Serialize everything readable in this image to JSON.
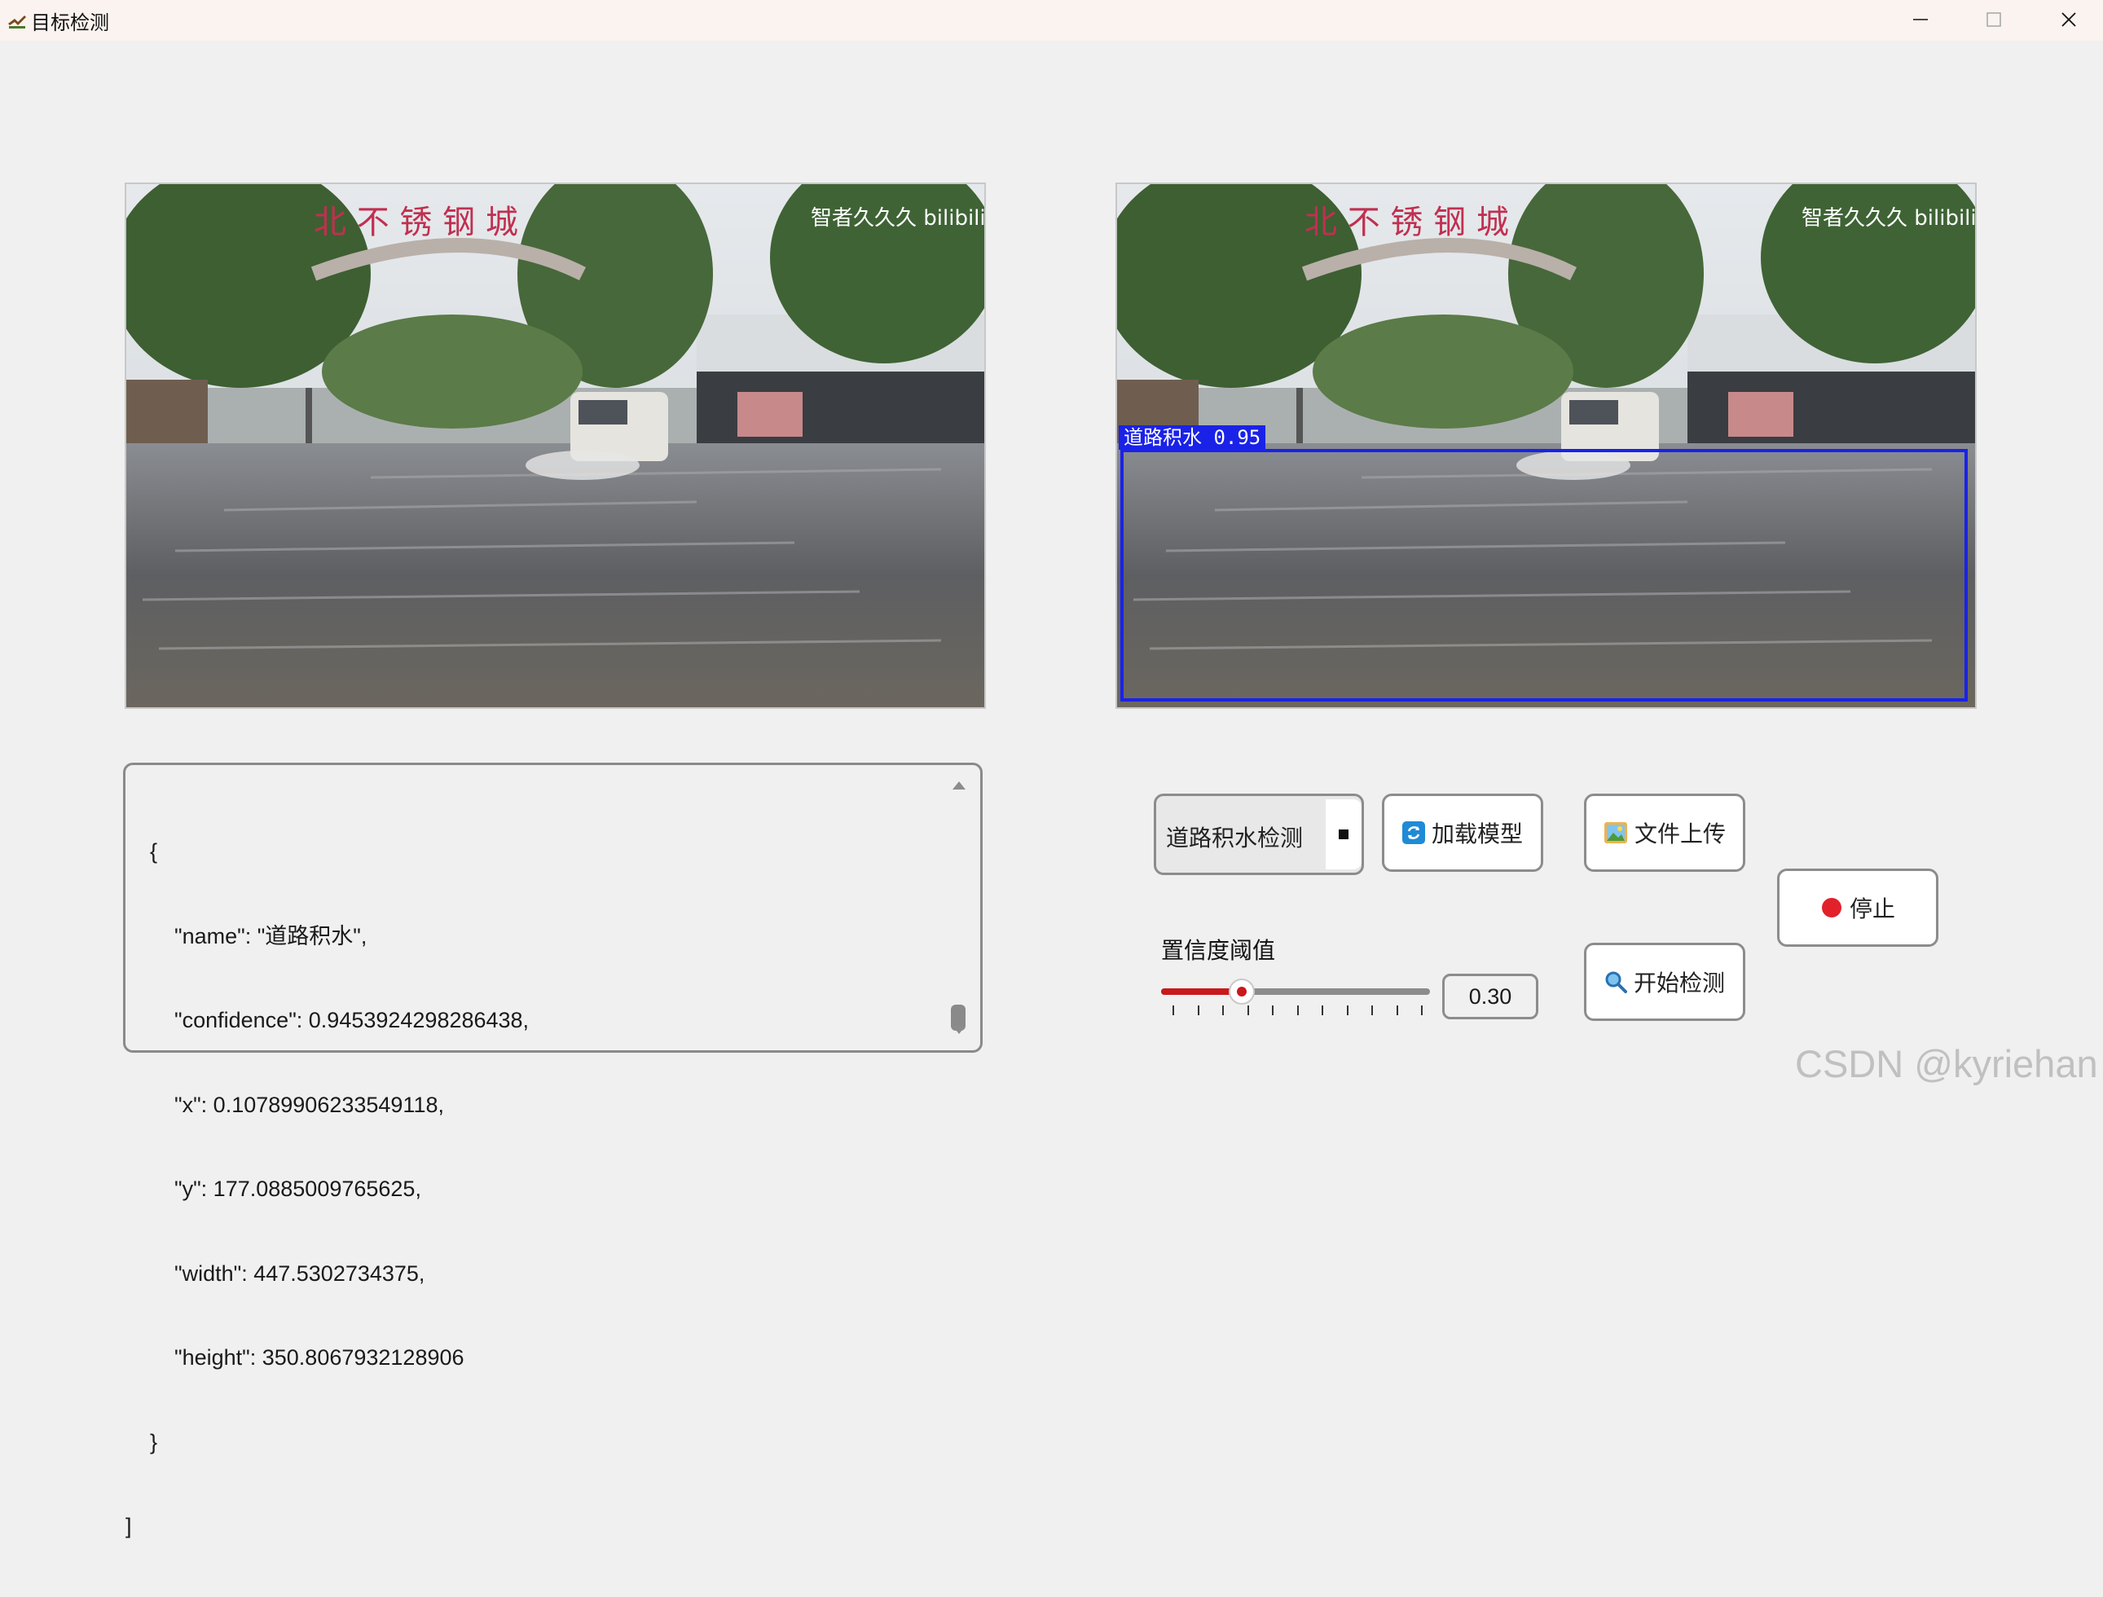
{
  "window": {
    "title": "目标检测",
    "controls": [
      "minimize-icon",
      "maximize-icon",
      "close-icon"
    ]
  },
  "images": {
    "source": {
      "watermark_text": "智者久久久 bilibili",
      "sign_text": "北 不 锈 钢 城"
    },
    "result": {
      "watermark_text": "智者久久久 bilibili",
      "sign_text": "北 不 锈 钢 城",
      "detection_label": "道路积水 0.95",
      "box_color": "#1a22e8"
    }
  },
  "result_json": {
    "lines": [
      "    {",
      "        \"name\": \"道路积水\",",
      "        \"confidence\": 0.9453924298286438,",
      "        \"x\": 0.10789906233549118,",
      "        \"y\": 177.0885009765625,",
      "        \"width\": 447.5302734375,",
      "        \"height\": 350.8067932128906",
      "    }",
      "]"
    ]
  },
  "controls": {
    "model_select": {
      "value": "道路积水检测"
    },
    "load_model": {
      "label": "加载模型",
      "icon": "refresh-icon"
    },
    "file_upload": {
      "label": "文件上传",
      "icon": "picture-icon"
    },
    "stop": {
      "label": "停止",
      "icon": "red-circle-icon"
    },
    "start_detect": {
      "label": "开始检测",
      "icon": "magnifier-icon"
    },
    "confidence": {
      "label": "置信度阈值",
      "value": "0.30",
      "fraction": 0.3
    }
  },
  "watermark": "CSDN @kyriehan",
  "colors": {
    "accent_red": "#c8191c",
    "detection_blue": "#1a22e8"
  }
}
